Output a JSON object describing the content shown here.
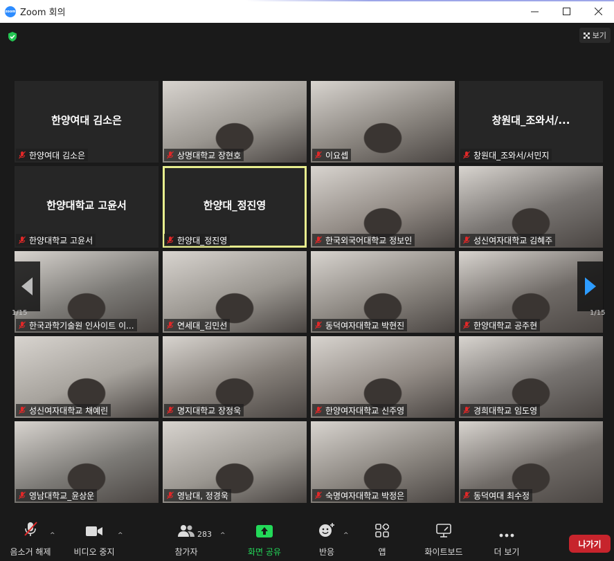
{
  "window": {
    "title": "Zoom 회의",
    "controls": [
      "minimize-icon",
      "maximize-icon",
      "close-icon"
    ]
  },
  "header": {
    "view_label": "보기"
  },
  "pager": {
    "left_page": "1/15",
    "right_page": "1/15"
  },
  "participants": [
    {
      "display": "한양여대 김소은",
      "name": "한양여대 김소은",
      "video": false,
      "active": false
    },
    {
      "display": "",
      "name": "상명대학교 장현호",
      "video": true,
      "active": false
    },
    {
      "display": "",
      "name": "이요셉",
      "video": true,
      "active": false
    },
    {
      "display": "창원대_조와서/...",
      "name": "창원대_조와서/서민지",
      "video": false,
      "active": false
    },
    {
      "display": "한양대학교 고윤서",
      "name": "한양대학교 고윤서",
      "video": false,
      "active": false
    },
    {
      "display": "한양대_정진영",
      "name": "한양대_정진영",
      "video": false,
      "active": true
    },
    {
      "display": "",
      "name": "한국외국어대학교 정보인",
      "video": true,
      "active": false
    },
    {
      "display": "",
      "name": "성신여자대학교 김혜주",
      "video": true,
      "active": false
    },
    {
      "display": "",
      "name": "한국과학기술원 인사이트 이...",
      "video": true,
      "active": false
    },
    {
      "display": "",
      "name": "연세대_김민선",
      "video": true,
      "active": false
    },
    {
      "display": "",
      "name": "동덕여자대학교 박현진",
      "video": true,
      "active": false
    },
    {
      "display": "",
      "name": "한양대학교 공주현",
      "video": true,
      "active": false
    },
    {
      "display": "",
      "name": "성신여자대학교 채예린",
      "video": true,
      "active": false
    },
    {
      "display": "",
      "name": "명지대학교 장정욱",
      "video": true,
      "active": false
    },
    {
      "display": "",
      "name": "한양여자대학교 신주영",
      "video": true,
      "active": false
    },
    {
      "display": "",
      "name": "경희대학교 임도영",
      "video": true,
      "active": false
    },
    {
      "display": "",
      "name": "영남대학교_윤상운",
      "video": true,
      "active": false
    },
    {
      "display": "",
      "name": "영남대, 정경욱",
      "video": true,
      "active": false
    },
    {
      "display": "",
      "name": "숙명여자대학교 박정은",
      "video": true,
      "active": false
    },
    {
      "display": "",
      "name": "동덕여대 최수정",
      "video": true,
      "active": false
    }
  ],
  "toolbar": {
    "unmute_label": "음소거 해제",
    "video_label": "비디오 중지",
    "participants_label": "참가자",
    "participants_count": "283",
    "share_label": "화면 공유",
    "reactions_label": "반응",
    "apps_label": "앱",
    "whiteboard_label": "화이트보드",
    "more_label": "더 보기",
    "leave_label": "나가기"
  },
  "colors": {
    "background": "#1a1a1a",
    "tile": "#262626",
    "active_border": "#e8ee8e",
    "share_green": "#23d959",
    "leave_red": "#c7242c",
    "mute_red": "#e02828"
  }
}
